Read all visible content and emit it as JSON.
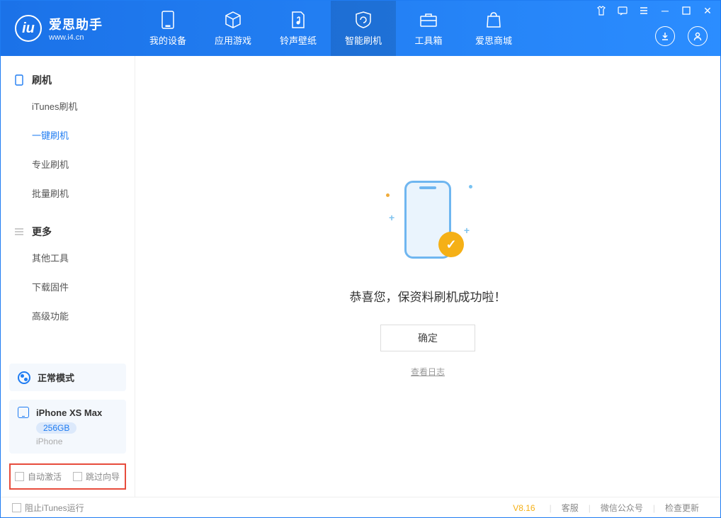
{
  "app": {
    "name": "爱思助手",
    "url": "www.i4.cn"
  },
  "nav": {
    "items": [
      {
        "label": "我的设备"
      },
      {
        "label": "应用游戏"
      },
      {
        "label": "铃声壁纸"
      },
      {
        "label": "智能刷机"
      },
      {
        "label": "工具箱"
      },
      {
        "label": "爱思商城"
      }
    ]
  },
  "sidebar": {
    "section1": {
      "title": "刷机",
      "items": [
        "iTunes刷机",
        "一键刷机",
        "专业刷机",
        "批量刷机"
      ]
    },
    "section2": {
      "title": "更多",
      "items": [
        "其他工具",
        "下载固件",
        "高级功能"
      ]
    },
    "mode": "正常模式",
    "device": {
      "name": "iPhone XS Max",
      "capacity": "256GB",
      "type": "iPhone"
    },
    "opts": {
      "auto_activate": "自动激活",
      "skip_guide": "跳过向导"
    }
  },
  "main": {
    "success_message": "恭喜您，保资料刷机成功啦！",
    "ok_label": "确定",
    "log_label": "查看日志"
  },
  "footer": {
    "block_itunes": "阻止iTunes运行",
    "version": "V8.16",
    "links": [
      "客服",
      "微信公众号",
      "检查更新"
    ]
  }
}
